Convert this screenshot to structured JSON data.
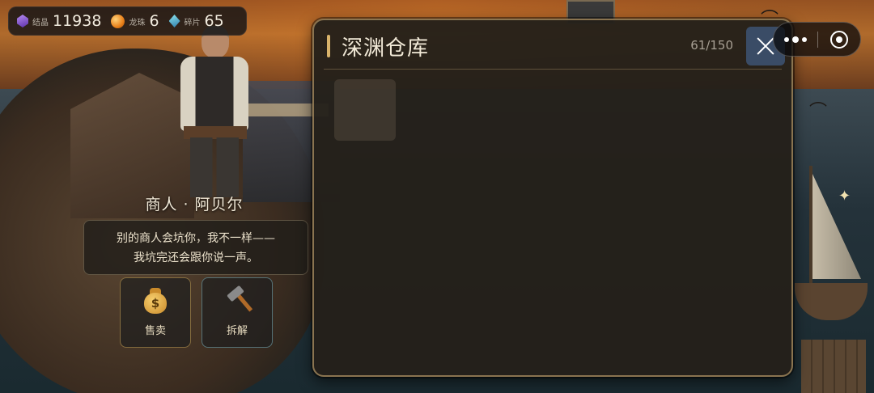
{
  "resources": [
    {
      "icon": "crystal-icon",
      "label": "结晶",
      "value": "11938"
    },
    {
      "icon": "dragon-orb-icon",
      "label": "龙珠",
      "value": "6"
    },
    {
      "icon": "fragment-icon",
      "label": "碎片",
      "value": "65"
    }
  ],
  "merchant": {
    "name": "商人 · 阿贝尔",
    "dialog_lines": [
      "别的商人会坑你，我不一样——",
      "我坑完还会跟你说一声。"
    ]
  },
  "actions": {
    "sell": {
      "label": "售卖",
      "icon": "money-bag-icon"
    },
    "dismantle": {
      "label": "拆解",
      "icon": "hammer-icon"
    }
  },
  "storage": {
    "title": "深渊仓库",
    "count": "61/150",
    "close_icon": "close-icon"
  },
  "capsule": {
    "more_icon": "more-dots-icon",
    "exit_icon": "target-icon"
  },
  "colors": {
    "accent_gold": "#d9b36a",
    "close_button": "#3a4c66",
    "panel_border": "#8a7450"
  }
}
